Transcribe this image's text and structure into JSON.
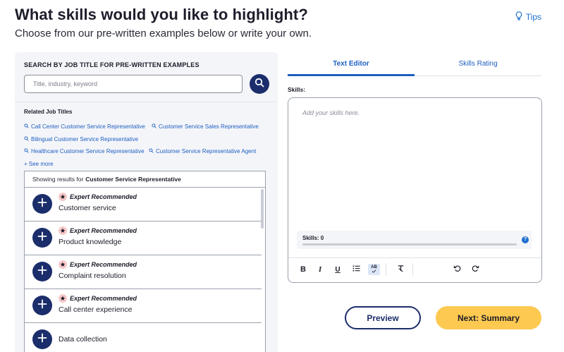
{
  "header": {
    "title": "What skills would you like to highlight?",
    "subtitle": "Choose from our pre-written examples below or write your own.",
    "tips_label": "Tips"
  },
  "search": {
    "header": "SEARCH BY JOB TITLE FOR PRE-WRITTEN EXAMPLES",
    "placeholder": "Title, industry, keyword",
    "value": ""
  },
  "related": {
    "header": "Related Job Titles",
    "links": [
      "Call Center Customer Service Representative",
      "Customer Service Sales Representative",
      "Bilingual Customer Service Representative",
      "Healthcare Customer Service Representative",
      "Customer Service Representative Agent"
    ],
    "see_more": "+ See more"
  },
  "results": {
    "prefix": "Showing results for",
    "query": "Customer Service Representative",
    "items": [
      {
        "badge": "Expert Recommended",
        "skill": "Customer service"
      },
      {
        "badge": "Expert Recommended",
        "skill": "Product knowledge"
      },
      {
        "badge": "Expert Recommended",
        "skill": "Complaint resolution"
      },
      {
        "badge": "Expert Recommended",
        "skill": "Call center experience"
      },
      {
        "badge": "",
        "skill": "Data collection"
      }
    ]
  },
  "tabs": [
    {
      "label": "Text Editor",
      "active": true
    },
    {
      "label": "Skills Rating",
      "active": false
    }
  ],
  "editor": {
    "label": "Skills:",
    "placeholder": "Add your skills here.",
    "meter_label": "Skills: 0",
    "meter_value": 0,
    "help": "?",
    "spell_label": "AB"
  },
  "actions": {
    "preview": "Preview",
    "next": "Next: Summary"
  },
  "colors": {
    "primary_navy": "#1b2d6b",
    "link_blue": "#1e5fc0",
    "accent_yellow": "#fdc950",
    "badge_pink": "#f7c8c8"
  }
}
